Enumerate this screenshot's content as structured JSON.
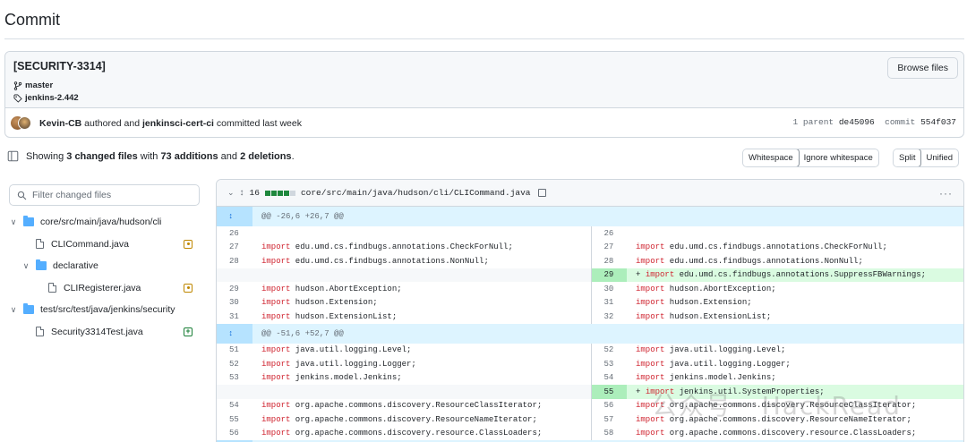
{
  "page": {
    "title": "Commit"
  },
  "commit": {
    "message": "[SECURITY-3314]",
    "branch": "master",
    "tag": "jenkins-2.442",
    "browse_label": "Browse files",
    "author": "Kevin-CB",
    "authored_text": " authored and ",
    "committer": "jenkinsci-cert-ci",
    "committed_text": " committed last week",
    "parent_label": "1 parent ",
    "parent_sha": "de45096",
    "commit_label": "commit ",
    "commit_sha": "554f037"
  },
  "summary": {
    "prefix": "Showing ",
    "files": "3 changed files",
    "mid": " with ",
    "additions": "73 additions",
    "and": " and ",
    "deletions": "2 deletions",
    "suffix": "."
  },
  "toggles": {
    "whitespace": "Whitespace",
    "ignore_whitespace": "Ignore whitespace",
    "split": "Split",
    "unified": "Unified"
  },
  "filter": {
    "placeholder": "Filter changed files"
  },
  "tree": [
    {
      "type": "folder",
      "label": "core/src/main/java/hudson/cli",
      "depth": 0
    },
    {
      "type": "file",
      "label": "CLICommand.java",
      "depth": 1,
      "status": "modified"
    },
    {
      "type": "folder",
      "label": "declarative",
      "depth": 1
    },
    {
      "type": "file",
      "label": "CLIRegisterer.java",
      "depth": 2,
      "status": "modified"
    },
    {
      "type": "folder",
      "label": "test/src/test/java/jenkins/security",
      "depth": 0
    },
    {
      "type": "file",
      "label": "Security3314Test.java",
      "depth": 1,
      "status": "added"
    }
  ],
  "diff_file": {
    "changes": "16",
    "path": "core/src/main/java/hudson/cli/CLICommand.java",
    "more": "···"
  },
  "diff_rows": [
    {
      "kind": "hunk",
      "text": "@@ -26,6 +26,7 @@"
    },
    {
      "kind": "ctx",
      "l": "26",
      "r": "26",
      "kw": "",
      "code": ""
    },
    {
      "kind": "ctx",
      "l": "27",
      "r": "27",
      "kw": "import",
      "code": " edu.umd.cs.findbugs.annotations.CheckForNull;"
    },
    {
      "kind": "ctx",
      "l": "28",
      "r": "28",
      "kw": "import",
      "code": " edu.umd.cs.findbugs.annotations.NonNull;"
    },
    {
      "kind": "add",
      "l": "",
      "r": "29",
      "kw": "import",
      "code": " edu.umd.cs.findbugs.annotations.SuppressFBWarnings;"
    },
    {
      "kind": "ctx",
      "l": "29",
      "r": "30",
      "kw": "import",
      "code": " hudson.AbortException;"
    },
    {
      "kind": "ctx",
      "l": "30",
      "r": "31",
      "kw": "import",
      "code": " hudson.Extension;"
    },
    {
      "kind": "ctx",
      "l": "31",
      "r": "32",
      "kw": "import",
      "code": " hudson.ExtensionList;"
    },
    {
      "kind": "hunk",
      "text": "@@ -51,6 +52,7 @@"
    },
    {
      "kind": "ctx",
      "l": "51",
      "r": "52",
      "kw": "import",
      "code": " java.util.logging.Level;"
    },
    {
      "kind": "ctx",
      "l": "52",
      "r": "53",
      "kw": "import",
      "code": " java.util.logging.Logger;"
    },
    {
      "kind": "ctx",
      "l": "53",
      "r": "54",
      "kw": "import",
      "code": " jenkins.model.Jenkins;"
    },
    {
      "kind": "add",
      "l": "",
      "r": "55",
      "kw": "import",
      "code": " jenkins.util.SystemProperties;"
    },
    {
      "kind": "ctx",
      "l": "54",
      "r": "56",
      "kw": "import",
      "code": " org.apache.commons.discovery.ResourceClassIterator;"
    },
    {
      "kind": "ctx",
      "l": "55",
      "r": "57",
      "kw": "import",
      "code": " org.apache.commons.discovery.ResourceNameIterator;"
    },
    {
      "kind": "ctx",
      "l": "56",
      "r": "58",
      "kw": "import",
      "code": " org.apache.commons.discovery.resource.ClassLoaders;"
    },
    {
      "kind": "hunk",
      "text": ""
    }
  ],
  "watermark": "公众号 · HackRead"
}
